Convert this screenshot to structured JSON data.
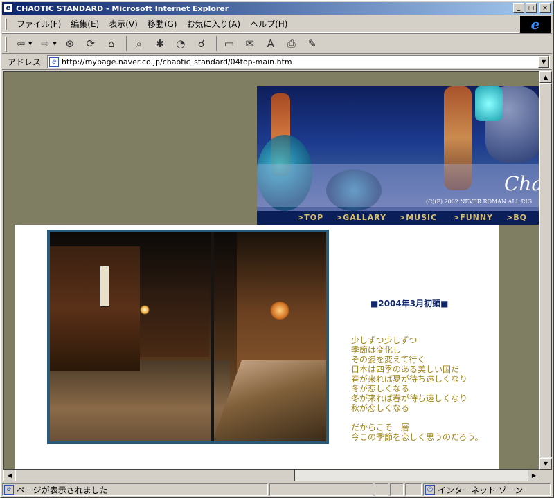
{
  "window": {
    "title": "CHAOTIC STANDARD - Microsoft Internet Explorer",
    "controls": [
      "_",
      "□",
      "×"
    ]
  },
  "menu": [
    "ファイル(F)",
    "編集(E)",
    "表示(V)",
    "移動(G)",
    "お気に入り(A)",
    "ヘルプ(H)"
  ],
  "toolbar": {
    "buttons": [
      "back-icon",
      "forward-icon",
      "stop-icon",
      "refresh-icon",
      "home-icon",
      "search-icon",
      "favorites-icon",
      "history-icon",
      "channels-icon",
      "fullscreen-icon",
      "mail-icon",
      "font-icon",
      "print-icon",
      "edit-icon"
    ]
  },
  "address": {
    "label": "アドレス",
    "url": "http://mypage.naver.co.jp/chaotic_standard/04top-main.htm"
  },
  "page": {
    "banner_logo": "Cha",
    "banner_copyright": "(C)(P) 2002 NEVER ROMAN ALL RIG",
    "nav": [
      ">TOP",
      ">GALLARY",
      ">MUSIC",
      ">FUNNY",
      ">BQ"
    ],
    "poem_title": "■2004年3月初頭■",
    "poem_lines": [
      "少しずつ少しずつ",
      "季節は変化し",
      "その姿を変えて行く",
      "日本は四季のある美しい国だ",
      "春が来れば夏が待ち遠しくなり",
      "冬が恋しくなる",
      "冬が来れば春が待ち遠しくなり",
      "秋が恋しくなる",
      "",
      "だからこそ一層",
      "今この季節を恋しく思うのだろう。"
    ]
  },
  "status": {
    "text": "ページが表示されました",
    "zone": "インターネット ゾーン"
  }
}
